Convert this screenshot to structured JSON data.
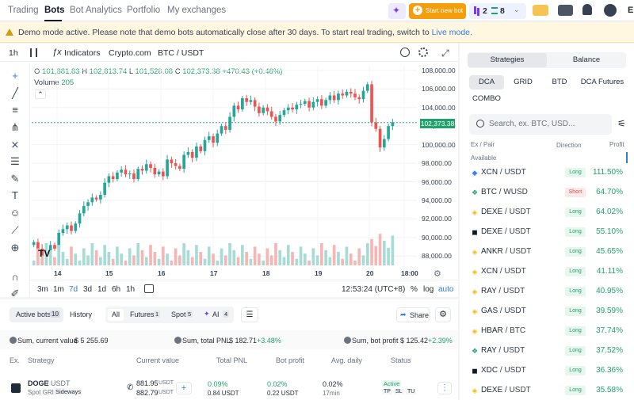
{
  "nav": {
    "items": [
      "Trading",
      "Bots",
      "Bot Analytics",
      "Portfolio",
      "My exchanges"
    ],
    "active": "Bots",
    "count_a": "2",
    "count_b": "8",
    "start_new_bot": "Start new bot",
    "user_initial": "E"
  },
  "banner": {
    "text": "Demo mode active. Please note that demo bots automatically close after 30 days. To start real trading, switch to",
    "link": "Live mode."
  },
  "toolbar": {
    "interval": "1h",
    "indicators": "Indicators",
    "exchange": "Crypto.com",
    "pair": "BTC / USDT"
  },
  "legend": {
    "o_label": "O",
    "o": "101,881.83",
    "h_label": "H",
    "h": "102,813.74",
    "l_label": "L",
    "l": "101,528.08",
    "c_label": "C",
    "c": "102,373.38",
    "change": "+470.43 (+0.46%)",
    "volume_label": "Volume",
    "volume": "205"
  },
  "chart_data": {
    "type": "candlestick",
    "y_ticks": [
      "108,000.00",
      "106,000.00",
      "104,000.00",
      "102,000.00",
      "100,000.00",
      "98,000.00",
      "96,000.00",
      "94,000.00",
      "92,000.00",
      "90,000.00",
      "88,000.00"
    ],
    "ylim": [
      87000,
      108500
    ],
    "x_ticks": [
      "14",
      "15",
      "16",
      "17",
      "18",
      "19",
      "20",
      "18:00"
    ],
    "last_price": "102,373.38",
    "close_series": [
      89500,
      88800,
      88000,
      88400,
      89200,
      88800,
      90500,
      90900,
      91300,
      90700,
      91500,
      92600,
      93400,
      93800,
      94300,
      94100,
      94600,
      95900,
      96600,
      96300,
      97000,
      97300,
      96800,
      96900,
      96300,
      97400,
      97200,
      97900,
      97500,
      96800,
      97100,
      96600,
      98400,
      98000,
      97700,
      97400,
      98900,
      99200,
      98600,
      99800,
      99300,
      100500,
      100900,
      100200,
      101200,
      102000,
      101600,
      103000,
      104200,
      103800,
      105000,
      104600,
      104800,
      104100,
      103400,
      104000,
      103600,
      103000,
      102500,
      103200,
      103700,
      104000,
      103800,
      104300,
      104400,
      104700,
      104000,
      104600,
      104900,
      104200,
      104800,
      105300,
      104800,
      105500,
      105300,
      105700,
      105500,
      105100,
      104900,
      105800,
      106500,
      102400,
      101700,
      99700,
      100600,
      102000,
      102400
    ]
  },
  "bottombar": {
    "ranges": [
      "3m",
      "1m",
      "7d",
      "3d",
      "1d",
      "6h",
      "1h"
    ],
    "active_range": "7d",
    "time": "12:53:24 (UTC+8)",
    "percent": "%",
    "log": "log",
    "auto": "auto"
  },
  "bots": {
    "tabs": [
      {
        "label": "Active bots",
        "count": "10"
      },
      {
        "label": "History",
        "count": ""
      }
    ],
    "filters": [
      {
        "label": "All",
        "count": ""
      },
      {
        "label": "Futures",
        "count": "1"
      },
      {
        "label": "Spot",
        "count": "5"
      },
      {
        "label": "AI",
        "count": "4"
      }
    ],
    "share": "Share",
    "sum_current_label": "Sum, current value",
    "sum_current": "$ 5 255.69",
    "sum_pnl_label": "Sum, total PNL",
    "sum_pnl": "$ 182.71",
    "sum_pnl_pct": "+3.48%",
    "sum_profit_label": "Sum, bot profit",
    "sum_profit": "$ 125.42",
    "sum_profit_pct": "+2.39%",
    "columns": [
      "Ex.",
      "Strategy",
      "Current value",
      "Total PNL",
      "Bot profit",
      "Avg. daily",
      "Status"
    ],
    "row": {
      "pair": "DOGE",
      "quote": "/ USDT",
      "type": "Spot GRID",
      "mode": "Sideways",
      "value1": "881.95",
      "value2": "882.79",
      "unit": "USDT",
      "pnl": "0.09%",
      "pnl_value": "0.84 USDT",
      "profit": "0.02%",
      "profit_value": "0.22 USDT",
      "avg": "0.02%",
      "avg_time": "17min",
      "status": "Active",
      "tags": [
        "TP",
        "SL",
        "TU"
      ]
    }
  },
  "sidebar": {
    "tabs": [
      "Strategies",
      "Balance"
    ],
    "types": [
      "DCA",
      "GRID",
      "BTD",
      "DCA Futures",
      "COMBO"
    ],
    "search_placeholder": "Search, ex. BTC, USD...",
    "col_pair": "Ex / Pair",
    "col_direction": "Direction",
    "col_profit": "Profit",
    "available": "Available",
    "rows": [
      {
        "pair": "XCN",
        "quote": "/ USDT",
        "direction": "Long",
        "profit": "111.50%"
      },
      {
        "pair": "BTC",
        "quote": "/ WUSD",
        "direction": "Short",
        "profit": "64.70%"
      },
      {
        "pair": "DEXE",
        "quote": "/ USDT",
        "direction": "Long",
        "profit": "64.02%"
      },
      {
        "pair": "DEXE",
        "quote": "/ USDT",
        "direction": "Long",
        "profit": "55.10%"
      },
      {
        "pair": "ANKR",
        "quote": "/ USDT",
        "direction": "Long",
        "profit": "45.65%"
      },
      {
        "pair": "XCN",
        "quote": "/ USDT",
        "direction": "Long",
        "profit": "41.11%"
      },
      {
        "pair": "RAY",
        "quote": "/ USDT",
        "direction": "Long",
        "profit": "40.95%"
      },
      {
        "pair": "GAS",
        "quote": "/ USDT",
        "direction": "Long",
        "profit": "39.59%"
      },
      {
        "pair": "HBAR",
        "quote": "/ BTC",
        "direction": "Long",
        "profit": "37.74%"
      },
      {
        "pair": "RAY",
        "quote": "/ USDT",
        "direction": "Long",
        "profit": "37.52%"
      },
      {
        "pair": "XDC",
        "quote": "/ USDT",
        "direction": "Long",
        "profit": "36.36%"
      },
      {
        "pair": "DEXE",
        "quote": "/ USDT",
        "direction": "Long",
        "profit": "35.58%"
      }
    ]
  }
}
